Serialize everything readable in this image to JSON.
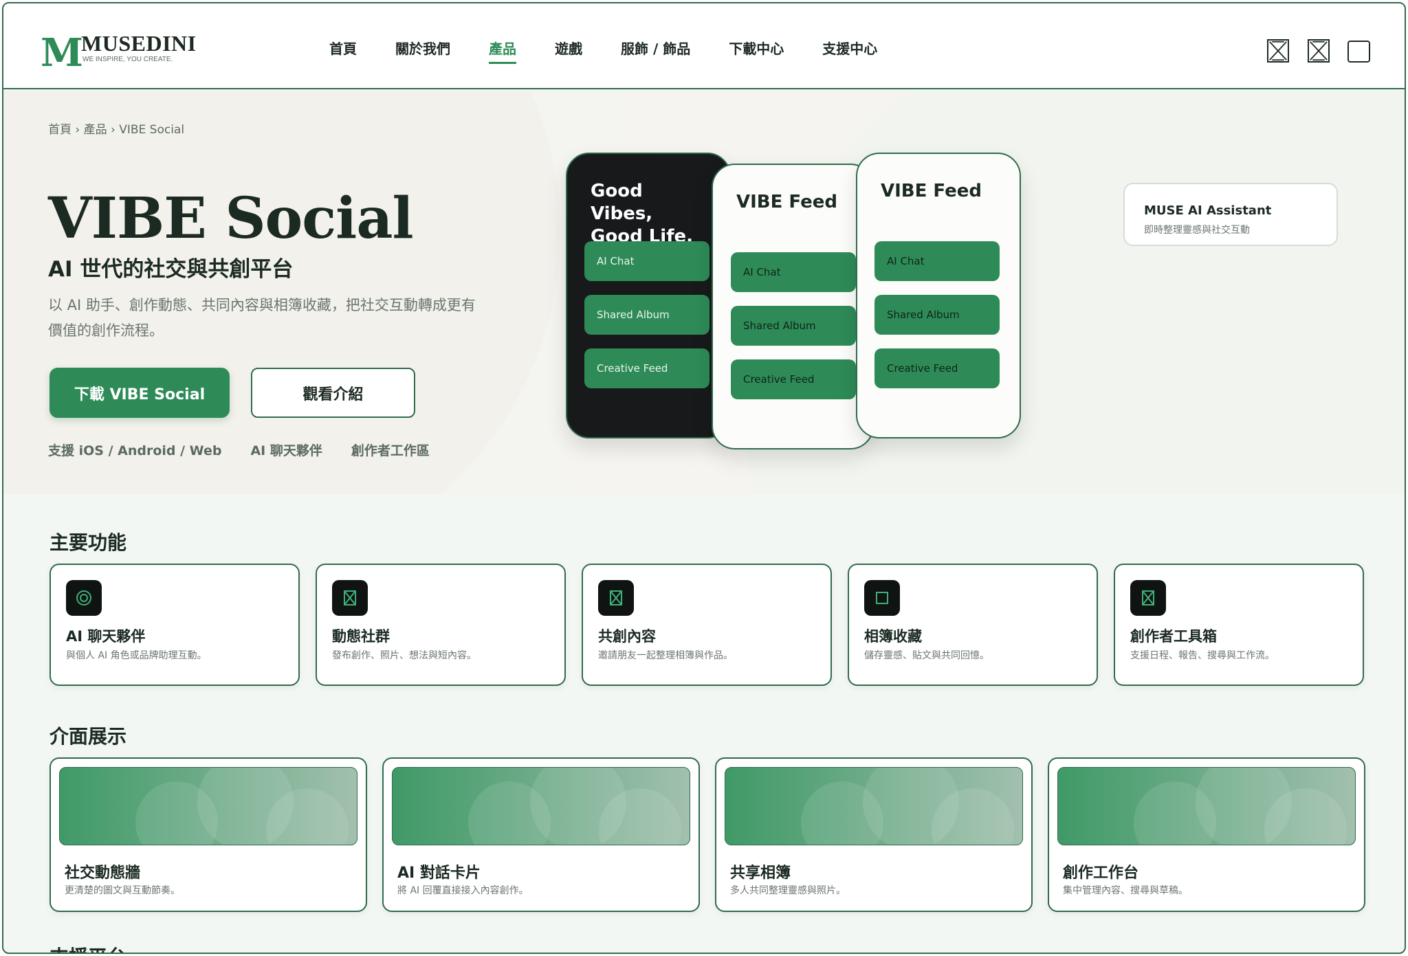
{
  "header": {
    "logo_mark": "M",
    "logo_name": "MUSEDINI",
    "logo_tagline": "WE INSPIRE, YOU CREATE.",
    "nav": [
      "首頁",
      "關於我們",
      "產品",
      "遊戲",
      "服飾 / 飾品",
      "下載中心",
      "支援中心"
    ],
    "active_nav": "產品",
    "icons": [
      "placeholder-icon",
      "placeholder-icon",
      "square-icon"
    ]
  },
  "hero": {
    "breadcrumb": "首頁 › 產品 › VIBE Social",
    "title": "VIBE Social",
    "subtitle": "AI 世代的社交與共創平台",
    "description": "以 AI 助手、創作動態、共同內容與相簿收藏，把社交互動轉成更有價值的創作流程。",
    "primary_button": "下載 VIBE Social",
    "secondary_button": "觀看介紹",
    "tags": [
      "支援 iOS / Android / Web",
      "AI 聊天夥伴",
      "創作者工作區"
    ]
  },
  "phones": {
    "dark": {
      "title": "Good Vibes, Good Life.",
      "buttons": [
        "AI Chat",
        "Shared Album",
        "Creative Feed"
      ]
    },
    "white1": {
      "title": "VIBE Feed",
      "buttons": [
        "AI Chat",
        "Shared Album",
        "Creative Feed"
      ]
    },
    "white2": {
      "title": "VIBE Feed",
      "buttons": [
        "AI Chat",
        "Shared Album",
        "Creative Feed"
      ]
    }
  },
  "assistant": {
    "title": "MUSE AI Assistant",
    "description": "即時整理靈感與社交互動"
  },
  "features": {
    "title": "主要功能",
    "items": [
      {
        "icon": "ring-icon",
        "title": "AI 聊天夥伴",
        "description": "與個人 AI 角色或品牌助理互動。"
      },
      {
        "icon": "placeholder-icon",
        "title": "動態社群",
        "description": "發布創作、照片、想法與短內容。"
      },
      {
        "icon": "placeholder-icon",
        "title": "共創內容",
        "description": "邀請朋友一起整理相簿與作品。"
      },
      {
        "icon": "square-icon",
        "title": "相簿收藏",
        "description": "儲存靈感、貼文與共同回憶。"
      },
      {
        "icon": "placeholder-icon",
        "title": "創作者工具箱",
        "description": "支援日程、報告、搜尋與工作流。"
      }
    ]
  },
  "showcase": {
    "title": "介面展示",
    "items": [
      {
        "title": "社交動態牆",
        "description": "更清楚的圖文與互動節奏。"
      },
      {
        "title": "AI 對話卡片",
        "description": "將 AI 回覆直接接入內容創作。"
      },
      {
        "title": "共享相簿",
        "description": "多人共同整理靈感與照片。"
      },
      {
        "title": "創作工作台",
        "description": "集中管理內容、搜尋與草稿。"
      }
    ]
  },
  "platform_section": {
    "title": "支援平台"
  },
  "colors": {
    "accent": "#2e8b57",
    "border": "#2f6b4b",
    "dark": "#17191b"
  }
}
